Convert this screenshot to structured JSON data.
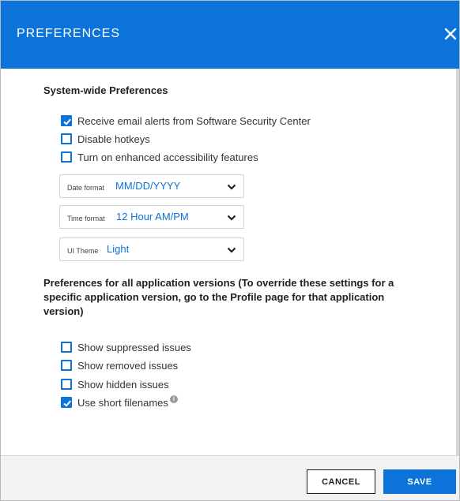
{
  "dialog": {
    "title": "PREFERENCES",
    "close_icon": "close-icon",
    "accent_color": "#0b73d9"
  },
  "system": {
    "heading": "System-wide Preferences",
    "checkboxes": [
      {
        "label": "Receive email alerts from Software Security Center",
        "checked": true
      },
      {
        "label": "Disable hotkeys",
        "checked": false
      },
      {
        "label": "Turn on enhanced accessibility features",
        "checked": false
      }
    ],
    "selects": [
      {
        "label": "Date format",
        "value": "MM/DD/YYYY"
      },
      {
        "label": "Time format",
        "value": "12 Hour AM/PM"
      },
      {
        "label": "UI Theme",
        "value": "Light"
      }
    ]
  },
  "app": {
    "heading_line1": "Preferences for all application versions (To override these settings for a",
    "heading_line2": "specific application version, go to the Profile page for that application",
    "heading_line3": "version)",
    "checkboxes": [
      {
        "label": "Show suppressed issues",
        "checked": false
      },
      {
        "label": "Show removed issues",
        "checked": false
      },
      {
        "label": "Show hidden issues",
        "checked": false
      },
      {
        "label": "Use short filenames",
        "checked": true,
        "info_icon": "info-icon"
      }
    ]
  },
  "footer": {
    "cancel_label": "CANCEL",
    "save_label": "SAVE"
  }
}
